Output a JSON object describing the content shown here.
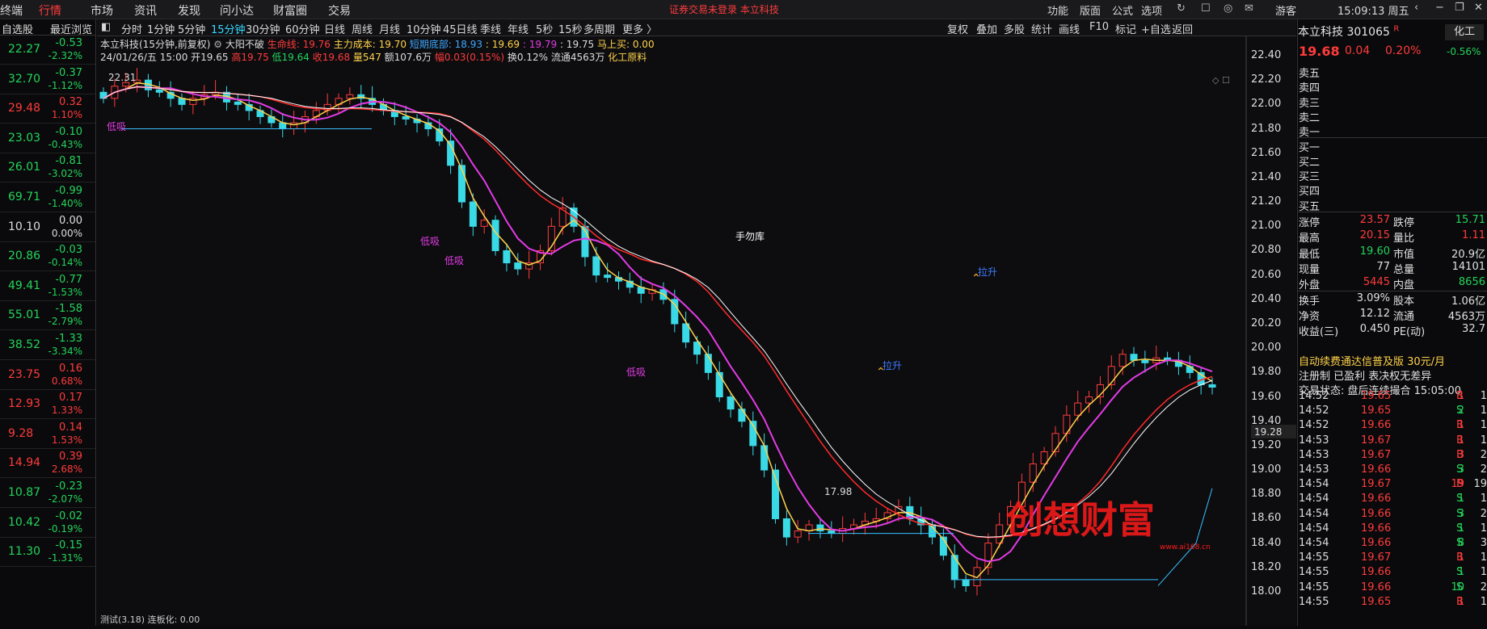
{
  "topbar": {
    "left_cut": "终端",
    "nav": [
      "行情",
      "市场",
      "资讯",
      "发现",
      "问小达",
      "财富圈",
      "交易"
    ],
    "notice": "证券交易未登录  本立科技",
    "right": [
      "功能",
      "版面",
      "公式",
      "选项"
    ],
    "guest": "游客",
    "clock": "15:09:13 周五"
  },
  "watch": {
    "tab1": "自选股",
    "tab2": "最近浏览",
    "rows": [
      {
        "price": "22.27",
        "chg": "-0.53",
        "pct": "-2.32%",
        "pc": "grn",
        "cc": "grn"
      },
      {
        "price": "32.70",
        "chg": "-0.37",
        "pct": "-1.12%",
        "pc": "grn",
        "cc": "grn"
      },
      {
        "price": "29.48",
        "chg": "0.32",
        "pct": "1.10%",
        "pc": "red",
        "cc": "red"
      },
      {
        "price": "23.03",
        "chg": "-0.10",
        "pct": "-0.43%",
        "pc": "grn",
        "cc": "grn"
      },
      {
        "price": "26.01",
        "chg": "-0.81",
        "pct": "-3.02%",
        "pc": "grn",
        "cc": "grn"
      },
      {
        "price": "69.71",
        "chg": "-0.99",
        "pct": "-1.40%",
        "pc": "grn",
        "cc": "grn"
      },
      {
        "price": "10.10",
        "chg": "0.00",
        "pct": "0.00%",
        "pc": "wht",
        "cc": "wht"
      },
      {
        "price": "20.86",
        "chg": "-0.03",
        "pct": "-0.14%",
        "pc": "grn",
        "cc": "grn"
      },
      {
        "price": "49.41",
        "chg": "-0.77",
        "pct": "-1.53%",
        "pc": "grn",
        "cc": "grn"
      },
      {
        "price": "55.01",
        "chg": "-1.58",
        "pct": "-2.79%",
        "pc": "grn",
        "cc": "grn"
      },
      {
        "price": "38.52",
        "chg": "-1.33",
        "pct": "-3.34%",
        "pc": "grn",
        "cc": "grn"
      },
      {
        "price": "23.75",
        "chg": "0.16",
        "pct": "0.68%",
        "pc": "red",
        "cc": "red"
      },
      {
        "price": "12.93",
        "chg": "0.17",
        "pct": "1.33%",
        "pc": "red",
        "cc": "red"
      },
      {
        "price": "9.28",
        "chg": "0.14",
        "pct": "1.53%",
        "pc": "red",
        "cc": "red"
      },
      {
        "price": "14.94",
        "chg": "0.39",
        "pct": "2.68%",
        "pc": "red",
        "cc": "red"
      },
      {
        "price": "10.87",
        "chg": "-0.23",
        "pct": "-2.07%",
        "pc": "grn",
        "cc": "grn"
      },
      {
        "price": "10.42",
        "chg": "-0.02",
        "pct": "-0.19%",
        "pc": "grn",
        "cc": "grn"
      },
      {
        "price": "11.30",
        "chg": "-0.15",
        "pct": "-1.31%",
        "pc": "grn",
        "cc": "grn"
      }
    ]
  },
  "periods": [
    "分时",
    "1分钟",
    "5分钟",
    "15分钟",
    "30分钟",
    "60分钟",
    "日线",
    "周线",
    "月线",
    "10分钟",
    "45日线",
    "季线",
    "年线",
    "5秒",
    "15秒",
    "多周期",
    "更多 〉"
  ],
  "selected_period": "15分钟",
  "chart_tools": [
    "复权",
    "叠加",
    "多股",
    "统计",
    "画线",
    "F10",
    "标记",
    "+自选",
    "返回"
  ],
  "info1": {
    "name": "本立科技(15分钟,前复权)",
    "ind": "大阳不破",
    "life": "生命线: 19.76",
    "cost": "主力成本: 19.70",
    "short": "短期底部: 18.93",
    "v1": ": 19.69",
    "v2": ": 19.79",
    "v3": ": 19.75",
    "buy": "马上买: 0.00"
  },
  "info2": {
    "date": "24/01/26/五 15:00",
    "open": "开19.65",
    "high": "高19.75",
    "low": "低19.64",
    "close": "收19.68",
    "vol": "量547",
    "amt": "额107.6万",
    "amp": "幅0.03(0.15%)",
    "turn": "换0.12% 流通4563万",
    "sector": "化工原料"
  },
  "annotations": {
    "high": "22.31",
    "low": "17.98",
    "center": "手勿库",
    "dixi": "低吸",
    "lashen": "拉升",
    "cursor": "19.28"
  },
  "bottom_tab": "测试(3.18)  连板化: 0.00",
  "watermark": "创想财富",
  "watermark_site": "www.ai168.cn",
  "quote": {
    "name": "本立科技 301065",
    "name_flag": "R",
    "price": "19.68",
    "chg": "0.04",
    "pct": "0.20%",
    "sector": "化工",
    "sector_pct": "-0.56%",
    "book": [
      "卖五",
      "卖四",
      "卖三",
      "卖二",
      "卖一",
      "买一",
      "买二",
      "买三",
      "买四",
      "买五"
    ],
    "stats": [
      [
        "涨停",
        "23.57",
        "跌停",
        "15.71"
      ],
      [
        "最高",
        "20.15",
        "量比",
        "1.11"
      ],
      [
        "最低",
        "19.60",
        "市值",
        "20.9亿"
      ],
      [
        "现量",
        "77",
        "总量",
        "14101"
      ],
      [
        "外盘",
        "5445",
        "内盘",
        "8656"
      ],
      [
        "换手",
        "3.09%",
        "股本",
        "1.06亿"
      ],
      [
        "净资",
        "12.12",
        "流通",
        "4563万"
      ],
      [
        "收益(三)",
        "0.450",
        "PE(动)",
        "32.7"
      ]
    ],
    "promo": "自动续费通达信普及版  30元/月",
    "tags": "注册制  已盈利  表决权无差异",
    "status": "交易状态: 盘后连续撮合 15:05:00",
    "ticks": [
      [
        "14:52",
        "19.65",
        "1",
        "B",
        "1"
      ],
      [
        "14:52",
        "19.65",
        "2",
        "S",
        "1"
      ],
      [
        "14:52",
        "19.66",
        "1",
        "B",
        "1"
      ],
      [
        "14:53",
        "19.67",
        "1",
        "B",
        "1"
      ],
      [
        "14:53",
        "19.67",
        "3",
        "B",
        "2"
      ],
      [
        "14:53",
        "19.66",
        "3",
        "S",
        "2"
      ],
      [
        "14:54",
        "19.67",
        "19",
        "B",
        "19"
      ],
      [
        "14:54",
        "19.66",
        "1",
        "S",
        "1"
      ],
      [
        "14:54",
        "19.66",
        "3",
        "S",
        "2"
      ],
      [
        "14:54",
        "19.66",
        "1",
        "S",
        "1"
      ],
      [
        "14:54",
        "19.66",
        "8",
        "S",
        "3"
      ],
      [
        "14:55",
        "19.67",
        "1",
        "B",
        "1"
      ],
      [
        "14:55",
        "19.66",
        "1",
        "S",
        "1"
      ],
      [
        "14:55",
        "19.66",
        "10",
        "S",
        "2"
      ],
      [
        "14:55",
        "19.65",
        "1",
        "B",
        "1"
      ]
    ]
  },
  "chart_data": {
    "type": "candlestick",
    "title": "本立科技(15分钟,前复权)",
    "ylim": [
      17.9,
      22.5
    ],
    "yticks": [
      18.0,
      18.2,
      18.4,
      18.6,
      18.8,
      19.0,
      19.2,
      19.4,
      19.6,
      19.8,
      20.0,
      20.2,
      20.4,
      20.6,
      20.8,
      21.0,
      21.2,
      21.4,
      21.6,
      21.8,
      22.0,
      22.2,
      22.4
    ],
    "close": [
      22.05,
      22.15,
      22.18,
      22.2,
      22.12,
      22.1,
      22.05,
      22.0,
      22.05,
      22.08,
      22.1,
      22.02,
      22.0,
      21.95,
      21.9,
      21.85,
      21.8,
      21.85,
      21.9,
      21.95,
      22.0,
      22.05,
      22.08,
      22.05,
      22.0,
      21.95,
      21.9,
      21.88,
      21.85,
      21.8,
      21.7,
      21.5,
      21.2,
      21.0,
      21.05,
      20.8,
      20.7,
      20.65,
      20.7,
      20.8,
      21.0,
      21.15,
      21.0,
      20.75,
      20.6,
      20.58,
      20.55,
      20.5,
      20.45,
      20.48,
      20.4,
      20.2,
      20.05,
      19.95,
      19.8,
      19.6,
      19.5,
      19.4,
      19.2,
      19.0,
      18.6,
      18.45,
      18.5,
      18.55,
      18.5,
      18.48,
      18.52,
      18.55,
      18.58,
      18.6,
      18.65,
      18.7,
      18.6,
      18.55,
      18.45,
      18.3,
      18.1,
      18.05,
      18.2,
      18.4,
      18.55,
      18.7,
      18.9,
      19.05,
      19.15,
      19.3,
      19.45,
      19.55,
      19.6,
      19.7,
      19.85,
      19.95,
      19.9,
      19.88,
      19.92,
      19.9,
      19.85,
      19.8,
      19.7,
      19.68
    ],
    "ma_labels": [
      "生命线",
      "主力成本",
      "短期底部"
    ]
  }
}
